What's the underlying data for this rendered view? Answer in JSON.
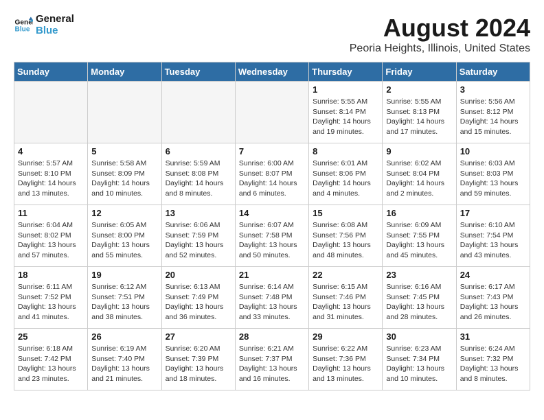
{
  "header": {
    "logo_line1": "General",
    "logo_line2": "Blue",
    "month_title": "August 2024",
    "location": "Peoria Heights, Illinois, United States"
  },
  "days_of_week": [
    "Sunday",
    "Monday",
    "Tuesday",
    "Wednesday",
    "Thursday",
    "Friday",
    "Saturday"
  ],
  "weeks": [
    [
      {
        "day": "",
        "info": ""
      },
      {
        "day": "",
        "info": ""
      },
      {
        "day": "",
        "info": ""
      },
      {
        "day": "",
        "info": ""
      },
      {
        "day": "1",
        "info": "Sunrise: 5:55 AM\nSunset: 8:14 PM\nDaylight: 14 hours\nand 19 minutes."
      },
      {
        "day": "2",
        "info": "Sunrise: 5:55 AM\nSunset: 8:13 PM\nDaylight: 14 hours\nand 17 minutes."
      },
      {
        "day": "3",
        "info": "Sunrise: 5:56 AM\nSunset: 8:12 PM\nDaylight: 14 hours\nand 15 minutes."
      }
    ],
    [
      {
        "day": "4",
        "info": "Sunrise: 5:57 AM\nSunset: 8:10 PM\nDaylight: 14 hours\nand 13 minutes."
      },
      {
        "day": "5",
        "info": "Sunrise: 5:58 AM\nSunset: 8:09 PM\nDaylight: 14 hours\nand 10 minutes."
      },
      {
        "day": "6",
        "info": "Sunrise: 5:59 AM\nSunset: 8:08 PM\nDaylight: 14 hours\nand 8 minutes."
      },
      {
        "day": "7",
        "info": "Sunrise: 6:00 AM\nSunset: 8:07 PM\nDaylight: 14 hours\nand 6 minutes."
      },
      {
        "day": "8",
        "info": "Sunrise: 6:01 AM\nSunset: 8:06 PM\nDaylight: 14 hours\nand 4 minutes."
      },
      {
        "day": "9",
        "info": "Sunrise: 6:02 AM\nSunset: 8:04 PM\nDaylight: 14 hours\nand 2 minutes."
      },
      {
        "day": "10",
        "info": "Sunrise: 6:03 AM\nSunset: 8:03 PM\nDaylight: 13 hours\nand 59 minutes."
      }
    ],
    [
      {
        "day": "11",
        "info": "Sunrise: 6:04 AM\nSunset: 8:02 PM\nDaylight: 13 hours\nand 57 minutes."
      },
      {
        "day": "12",
        "info": "Sunrise: 6:05 AM\nSunset: 8:00 PM\nDaylight: 13 hours\nand 55 minutes."
      },
      {
        "day": "13",
        "info": "Sunrise: 6:06 AM\nSunset: 7:59 PM\nDaylight: 13 hours\nand 52 minutes."
      },
      {
        "day": "14",
        "info": "Sunrise: 6:07 AM\nSunset: 7:58 PM\nDaylight: 13 hours\nand 50 minutes."
      },
      {
        "day": "15",
        "info": "Sunrise: 6:08 AM\nSunset: 7:56 PM\nDaylight: 13 hours\nand 48 minutes."
      },
      {
        "day": "16",
        "info": "Sunrise: 6:09 AM\nSunset: 7:55 PM\nDaylight: 13 hours\nand 45 minutes."
      },
      {
        "day": "17",
        "info": "Sunrise: 6:10 AM\nSunset: 7:54 PM\nDaylight: 13 hours\nand 43 minutes."
      }
    ],
    [
      {
        "day": "18",
        "info": "Sunrise: 6:11 AM\nSunset: 7:52 PM\nDaylight: 13 hours\nand 41 minutes."
      },
      {
        "day": "19",
        "info": "Sunrise: 6:12 AM\nSunset: 7:51 PM\nDaylight: 13 hours\nand 38 minutes."
      },
      {
        "day": "20",
        "info": "Sunrise: 6:13 AM\nSunset: 7:49 PM\nDaylight: 13 hours\nand 36 minutes."
      },
      {
        "day": "21",
        "info": "Sunrise: 6:14 AM\nSunset: 7:48 PM\nDaylight: 13 hours\nand 33 minutes."
      },
      {
        "day": "22",
        "info": "Sunrise: 6:15 AM\nSunset: 7:46 PM\nDaylight: 13 hours\nand 31 minutes."
      },
      {
        "day": "23",
        "info": "Sunrise: 6:16 AM\nSunset: 7:45 PM\nDaylight: 13 hours\nand 28 minutes."
      },
      {
        "day": "24",
        "info": "Sunrise: 6:17 AM\nSunset: 7:43 PM\nDaylight: 13 hours\nand 26 minutes."
      }
    ],
    [
      {
        "day": "25",
        "info": "Sunrise: 6:18 AM\nSunset: 7:42 PM\nDaylight: 13 hours\nand 23 minutes."
      },
      {
        "day": "26",
        "info": "Sunrise: 6:19 AM\nSunset: 7:40 PM\nDaylight: 13 hours\nand 21 minutes."
      },
      {
        "day": "27",
        "info": "Sunrise: 6:20 AM\nSunset: 7:39 PM\nDaylight: 13 hours\nand 18 minutes."
      },
      {
        "day": "28",
        "info": "Sunrise: 6:21 AM\nSunset: 7:37 PM\nDaylight: 13 hours\nand 16 minutes."
      },
      {
        "day": "29",
        "info": "Sunrise: 6:22 AM\nSunset: 7:36 PM\nDaylight: 13 hours\nand 13 minutes."
      },
      {
        "day": "30",
        "info": "Sunrise: 6:23 AM\nSunset: 7:34 PM\nDaylight: 13 hours\nand 10 minutes."
      },
      {
        "day": "31",
        "info": "Sunrise: 6:24 AM\nSunset: 7:32 PM\nDaylight: 13 hours\nand 8 minutes."
      }
    ]
  ]
}
